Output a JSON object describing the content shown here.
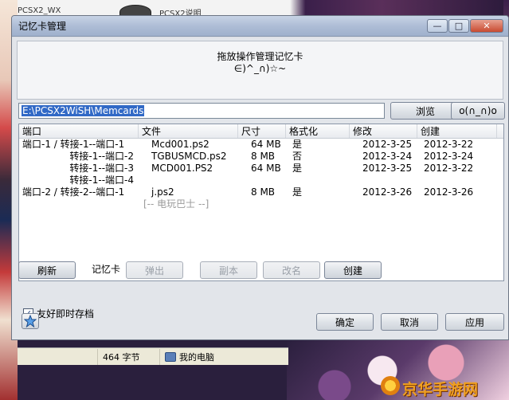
{
  "desktop": {
    "top_left_label": "PCSX2_WX",
    "top_right_label": "PCSX2说明"
  },
  "window": {
    "title": "记忆卡管理",
    "min_glyph": "—",
    "max_glyph": "□",
    "close_glyph": "✕"
  },
  "banner": {
    "line1": "拖放操作管理记忆卡",
    "line2": "∈)^_∩)☆~"
  },
  "path": {
    "value": "E:\\PCSX2WiSH\\Memcards"
  },
  "buttons": {
    "browse": "浏览",
    "face": "o(∩_∩)o",
    "refresh": "刷新",
    "eject": "弹出",
    "copy": "副本",
    "rename": "改名",
    "create": "创建",
    "ok": "确定",
    "cancel": "取消",
    "apply": "应用"
  },
  "memcard_label": "记忆卡",
  "table": {
    "columns": [
      "端口",
      "文件",
      "尺寸",
      "格式化",
      "修改",
      "创建"
    ],
    "rows": [
      {
        "port": "端口-1 / 转接-1--端口-1",
        "file": "Mcd001.ps2",
        "size": "64 MB",
        "formatted": "是",
        "modified": "2012-3-25",
        "created": "2012-3-22",
        "align": "left"
      },
      {
        "port": "转接-1--端口-2",
        "file": "TGBUSMCD.ps2",
        "size": "8 MB",
        "formatted": "否",
        "modified": "2012-3-24",
        "created": "2012-3-24",
        "align": "right"
      },
      {
        "port": "转接-1--端口-3",
        "file": "MCD001.PS2",
        "size": "64 MB",
        "formatted": "是",
        "modified": "2012-3-25",
        "created": "2012-3-22",
        "align": "right"
      },
      {
        "port": "转接-1--端口-4",
        "file": "",
        "size": "",
        "formatted": "",
        "modified": "",
        "created": "",
        "align": "right"
      },
      {
        "port": "端口-2 / 转接-2--端口-1",
        "file": "j.ps2",
        "size": "8 MB",
        "formatted": "是",
        "modified": "2012-3-26",
        "created": "2012-3-26",
        "align": "left"
      },
      {
        "port": "",
        "file": "[-- 电玩巴士 --]",
        "size": "",
        "formatted": "",
        "modified": "",
        "created": "",
        "align": "muted"
      }
    ]
  },
  "checkbox": {
    "label": "友好即时存档",
    "checked": true,
    "glyph": "✓"
  },
  "star_icon": "star-icon",
  "statusbar": {
    "size_text": "464 字节",
    "computer_text": "我的电脑"
  },
  "watermark": {
    "text": "京华手游网"
  }
}
